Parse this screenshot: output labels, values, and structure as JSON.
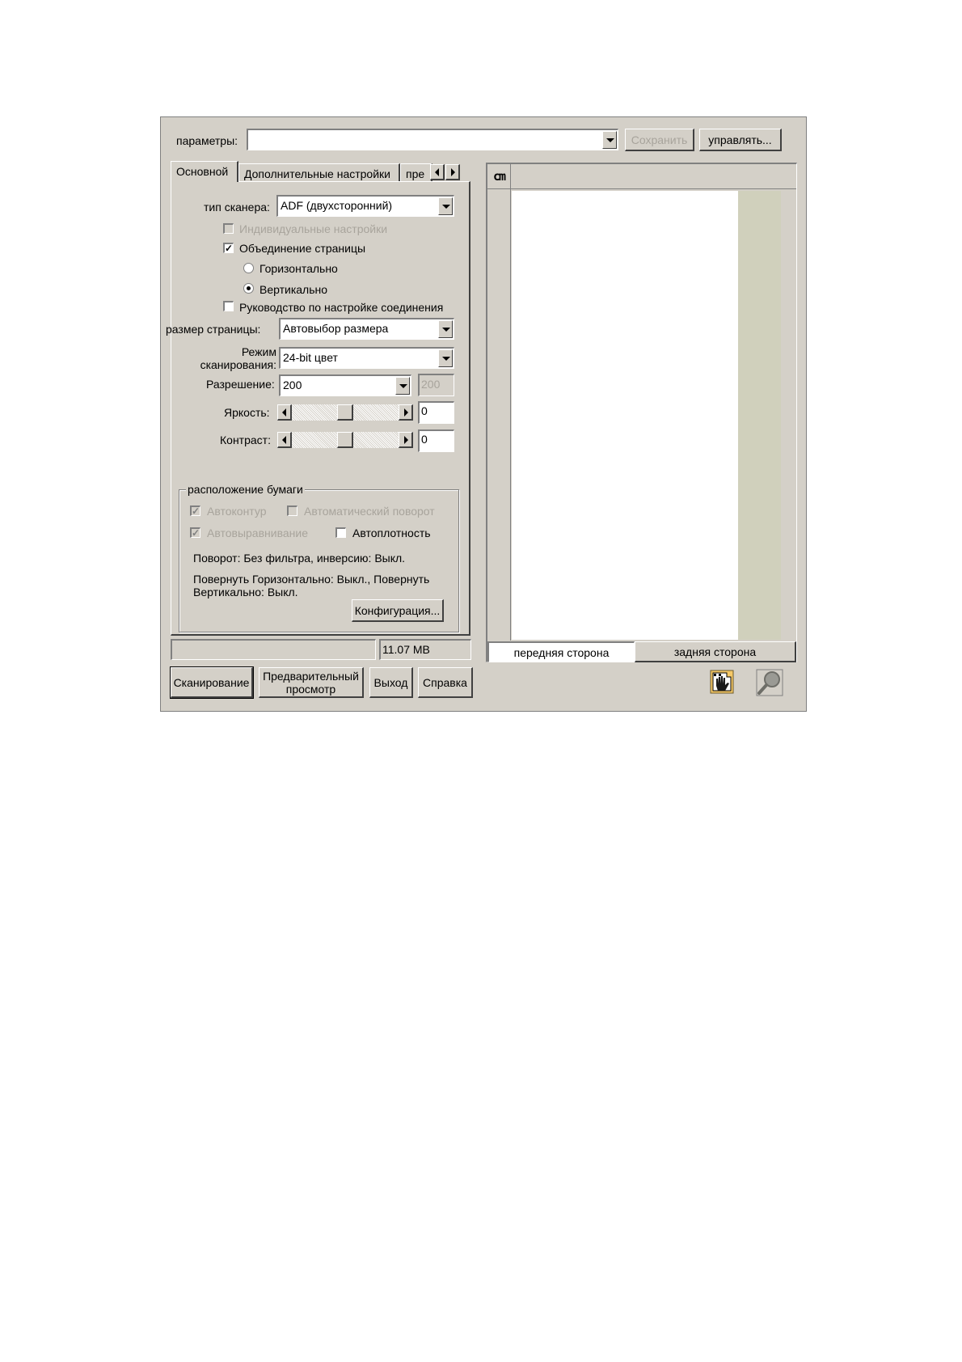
{
  "top": {
    "params_label": "параметры:",
    "params_value": "",
    "save_button": "Сохранить",
    "manage_button": "управлять..."
  },
  "tabs": [
    {
      "label": "Основной",
      "active": true
    },
    {
      "label": "Дополнительные настройки",
      "active": false
    },
    {
      "label": "пре",
      "active": false
    }
  ],
  "basic": {
    "scanner_type_label": "тип сканера:",
    "scanner_type_value": "ADF (двухсторонний)",
    "individual_settings": "Индивидуальные настройки",
    "page_merge": "Объединение страницы",
    "horizontal": "Горизонтально",
    "vertical": "Вертикально",
    "connection_guide": "Руководство по настройке соединения",
    "page_size_label": "размер страницы:",
    "page_size_value": "Автовыбор размера",
    "scan_mode_label_1": "Режим",
    "scan_mode_label_2": "сканирования:",
    "scan_mode_value": "24-bit цвет",
    "resolution_label": "Разрешение:",
    "resolution_value": "200",
    "resolution_custom": "200",
    "brightness_label": "Яркость:",
    "brightness_value": "0",
    "contrast_label": "Контраст:",
    "contrast_value": "0"
  },
  "paper": {
    "title": "расположение бумаги",
    "auto_contour": "Автоконтур",
    "auto_rotate": "Автоматический поворот",
    "auto_align": "Автовыравнивание",
    "auto_density": "Автоплотность",
    "rotation_text": "Поворот: Без фильтра, инверсию: Выкл.",
    "flip_text_1": "Повернуть Горизонтально: Выкл., Повернуть",
    "flip_text_2": "Вертикально: Выкл.",
    "config_button": "Конфигурация..."
  },
  "status": {
    "left": "",
    "memory": "11.07 MB"
  },
  "buttons": {
    "scan": "Сканирование",
    "preview_1": "Предварительный",
    "preview_2": "просмотр",
    "exit": "Выход",
    "help": "Справка"
  },
  "preview": {
    "unit": "cm",
    "front_tab": "передняя сторона",
    "back_tab": "задняя сторона"
  },
  "colors": {
    "dialog_bg": "#d4d0c8",
    "preview_margin": "#d0d0bc"
  },
  "icons": [
    "scan-hand-icon",
    "zoom-magnifier-icon"
  ]
}
